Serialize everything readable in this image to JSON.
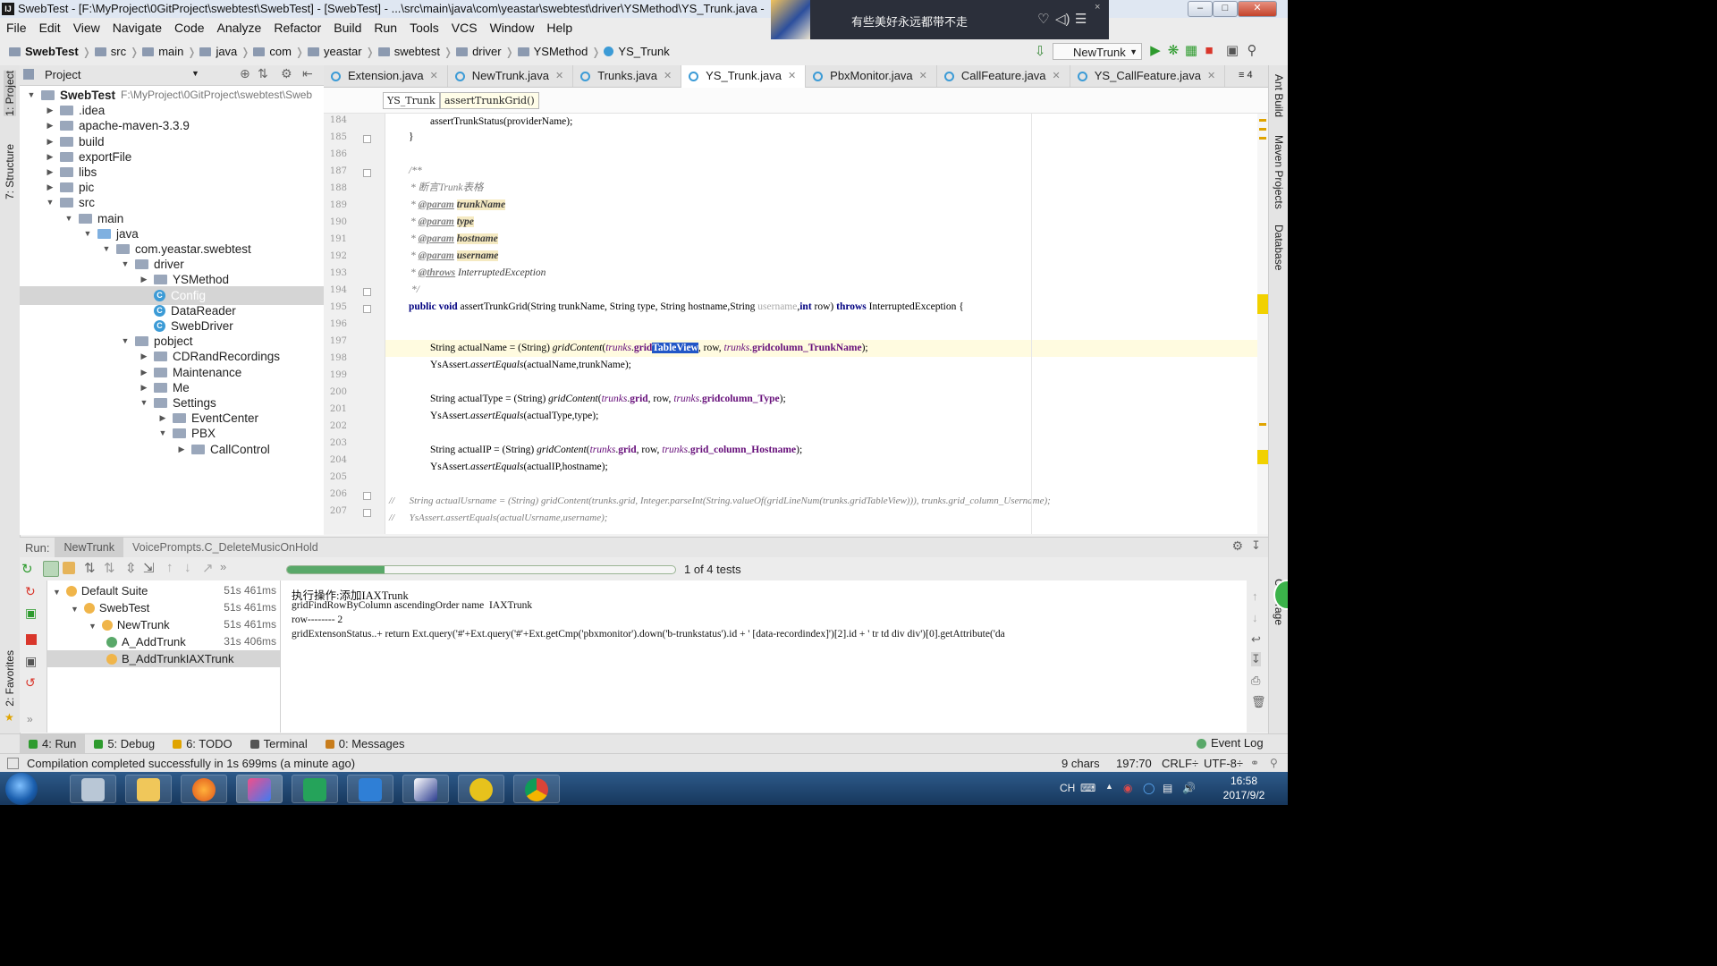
{
  "window": {
    "title": "SwebTest - [F:\\MyProject\\0GitProject\\swebtest\\SwebTest] - [SwebTest] - ...\\src\\main\\java\\com\\yeastar\\swebtest\\driver\\YSMethod\\YS_Trunk.java -",
    "app_icon": "IJ",
    "minimize": "–",
    "maximize": "□",
    "close": "✕"
  },
  "music_popup": {
    "text": "有些美好永远都带不走",
    "like_icon": "♡",
    "volume_icon": "◁)",
    "list_icon": "☰",
    "close_icon": "×"
  },
  "menu": [
    "File",
    "Edit",
    "View",
    "Navigate",
    "Code",
    "Analyze",
    "Refactor",
    "Build",
    "Run",
    "Tools",
    "VCS",
    "Window",
    "Help"
  ],
  "breadcrumb": [
    "SwebTest",
    "src",
    "main",
    "java",
    "com",
    "yeastar",
    "swebtest",
    "driver",
    "YSMethod",
    "YS_Trunk"
  ],
  "run_config": "NewTrunk",
  "left_stripe": {
    "project": "1: Project",
    "structure": "7: Structure",
    "favorites": "2: Favorites"
  },
  "right_stripe": {
    "ant": "Ant Build",
    "maven": "Maven Projects",
    "database": "Database",
    "coverage": "Coverage"
  },
  "project_panel": {
    "title": "Project",
    "tree": [
      {
        "label": "SwebTest",
        "extra": "F:\\MyProject\\0GitProject\\swebtest\\Sweb",
        "depth": 0,
        "arrow": "▼",
        "icon": "module",
        "bold": true
      },
      {
        "label": ".idea",
        "depth": 1,
        "arrow": "▶",
        "icon": "folder"
      },
      {
        "label": "apache-maven-3.3.9",
        "depth": 1,
        "arrow": "▶",
        "icon": "folder"
      },
      {
        "label": "build",
        "depth": 1,
        "arrow": "▶",
        "icon": "folder"
      },
      {
        "label": "exportFile",
        "depth": 1,
        "arrow": "▶",
        "icon": "folder"
      },
      {
        "label": "libs",
        "depth": 1,
        "arrow": "▶",
        "icon": "folder"
      },
      {
        "label": "pic",
        "depth": 1,
        "arrow": "▶",
        "icon": "folder"
      },
      {
        "label": "src",
        "depth": 1,
        "arrow": "▼",
        "icon": "folder"
      },
      {
        "label": "main",
        "depth": 2,
        "arrow": "▼",
        "icon": "folder"
      },
      {
        "label": "java",
        "depth": 3,
        "arrow": "▼",
        "icon": "src"
      },
      {
        "label": "com.yeastar.swebtest",
        "depth": 4,
        "arrow": "▼",
        "icon": "folder"
      },
      {
        "label": "driver",
        "depth": 5,
        "arrow": "▼",
        "icon": "folder"
      },
      {
        "label": "YSMethod",
        "depth": 6,
        "arrow": "▶",
        "icon": "folder"
      },
      {
        "label": "Config",
        "depth": 6,
        "arrow": "",
        "icon": "class",
        "selected": true
      },
      {
        "label": "DataReader",
        "depth": 6,
        "arrow": "",
        "icon": "class"
      },
      {
        "label": "SwebDriver",
        "depth": 6,
        "arrow": "",
        "icon": "class"
      },
      {
        "label": "pobject",
        "depth": 5,
        "arrow": "▼",
        "icon": "folder"
      },
      {
        "label": "CDRandRecordings",
        "depth": 6,
        "arrow": "▶",
        "icon": "folder"
      },
      {
        "label": "Maintenance",
        "depth": 6,
        "arrow": "▶",
        "icon": "folder"
      },
      {
        "label": "Me",
        "depth": 6,
        "arrow": "▶",
        "icon": "folder"
      },
      {
        "label": "Settings",
        "depth": 6,
        "arrow": "▼",
        "icon": "folder"
      },
      {
        "label": "EventCenter",
        "depth": 7,
        "arrow": "▶",
        "icon": "folder"
      },
      {
        "label": "PBX",
        "depth": 7,
        "arrow": "▼",
        "icon": "folder"
      },
      {
        "label": "CallControl",
        "depth": 8,
        "arrow": "▶",
        "icon": "folder"
      }
    ]
  },
  "tabs": [
    {
      "label": "Extension.java"
    },
    {
      "label": "NewTrunk.java"
    },
    {
      "label": "Trunks.java"
    },
    {
      "label": "YS_Trunk.java",
      "active": true
    },
    {
      "label": "PbxMonitor.java"
    },
    {
      "label": "CallFeature.java"
    },
    {
      "label": "YS_CallFeature.java"
    }
  ],
  "tab_overflow": "≡ 4",
  "editor_breadcrumb": [
    "YS_Trunk",
    "assertTrunkGrid()"
  ],
  "line_numbers": [
    "184",
    "185",
    "186",
    "187",
    "188",
    "189",
    "190",
    "191",
    "192",
    "193",
    "194",
    "195",
    "196",
    "197",
    "198",
    "199",
    "200",
    "201",
    "202",
    "203",
    "204",
    "205",
    "206",
    "207"
  ],
  "code": {
    "l184": "assertTrunkStatus(providerName);",
    "l185": "}",
    "l187": "/**",
    "l188_star": "* ",
    "l188": "断言Trunk表格",
    "param_tag": "@param",
    "throws_tag": "@throws",
    "p1": "trunkName",
    "p2": "type",
    "p3": "hostname",
    "p4": "username",
    "ex": "InterruptedException",
    "l194": "*/",
    "kw_public": "public",
    "kw_void": "void",
    "kw_int": "int",
    "kw_throws": "throws",
    "l195_a": " assertTrunkGrid(String trunkName, String type, String hostname,String ",
    "l195_user": "username",
    "l195_b": ",",
    "l195_c": " row) ",
    "l195_d": " InterruptedException {",
    "l197_a": "String actualName = (String) ",
    "gridContent": "gridContent",
    "trunks": "trunks",
    "grid": "grid",
    "l197_sel": "TableView",
    "l197_b": ", row, ",
    "l197_col": "gridcolumn_TrunkName",
    "l197_end": ");",
    "l198_a": "YsAssert.",
    "assertEquals": "assertEquals",
    "l198_b": "(actualName,trunkName);",
    "l200_a": "String actualType = (String) ",
    "l200_col": "gridcolumn_Type",
    "l201_b": "(actualType,type);",
    "l203_a": "String actualIP = (String) ",
    "l203_col": "grid_column_Hostname",
    "l204_b": "(actualIP,hostname);",
    "l206": "//      String actualUsrname = (String) gridContent(trunks.grid, Integer.parseInt(String.valueOf(gridLineNum(trunks.gridTableView))), trunks.grid_column_Username);",
    "l207": "//      YsAssert.assertEquals(actualUsrname,username);"
  },
  "run_panel": {
    "label": "Run:",
    "tabs": [
      "NewTrunk",
      "VoicePrompts.C_DeleteMusicOnHold"
    ],
    "progress_fraction": 0.25,
    "progress_text": "1 of 4 tests",
    "tree": [
      {
        "label": "Default Suite",
        "time": "51s 461ms",
        "depth": 0,
        "status": "warn"
      },
      {
        "label": "SwebTest",
        "time": "51s 461ms",
        "depth": 1,
        "status": "warn"
      },
      {
        "label": "NewTrunk",
        "time": "51s 461ms",
        "depth": 2,
        "status": "warn"
      },
      {
        "label": "A_AddTrunk",
        "time": "31s 406ms",
        "depth": 3,
        "status": "ok"
      },
      {
        "label": "B_AddTrunkIAXTrunk",
        "time": "",
        "depth": 3,
        "status": "warn",
        "selected": true
      }
    ],
    "console": [
      "执行操作:添加IAXTrunk",
      "gridFindRowByColumn ascendingOrder name  IAXTrunk",
      "row-------- 2",
      "gridExtensonStatus..+ return Ext.query('#'+Ext.query('#'+Ext.getCmp('pbxmonitor').down('b-trunkstatus').id + ' [data-recordindex]')[2].id + ' tr td div div')[0].getAttribute('da"
    ]
  },
  "bottom_tabs": [
    {
      "label": "4: Run",
      "active": true
    },
    {
      "label": "5: Debug"
    },
    {
      "label": "6: TODO"
    },
    {
      "label": "Terminal"
    },
    {
      "label": "0: Messages"
    }
  ],
  "event_log": "Event Log",
  "status": {
    "message": "Compilation completed successfully in 1s 699ms (a minute ago)",
    "chars": "9 chars",
    "position": "197:70",
    "line_sep": "CRLF÷",
    "encoding": "UTF-8÷"
  },
  "taskbar": {
    "lang": "CH",
    "time": "16:58",
    "date": "2017/9/2"
  },
  "colors": {
    "selection": "#2156c7",
    "keyword": "#000080",
    "field": "#660e7a",
    "progress": "#59a869"
  }
}
